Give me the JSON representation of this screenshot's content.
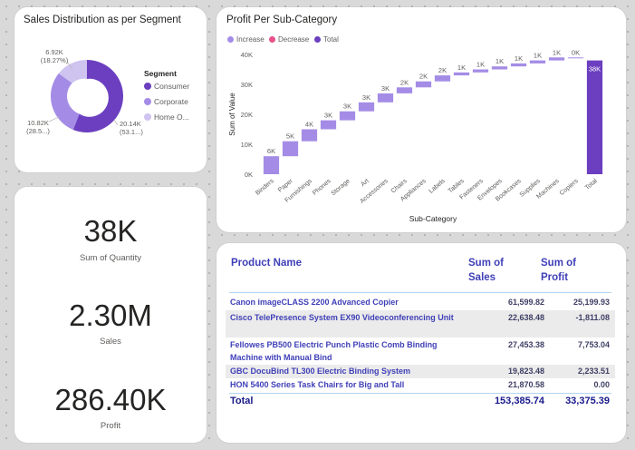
{
  "donut_card": {
    "title": "Sales Distribution as per Segment",
    "legend_title": "Segment",
    "legend": [
      {
        "label": "Consumer",
        "color": "#6b3fbf"
      },
      {
        "label": "Corporate",
        "color": "#a48ce6"
      },
      {
        "label": "Home O...",
        "color": "#cfc3f0"
      }
    ],
    "slice_labels": {
      "consumer_value": "20.14K",
      "consumer_pct": "(53.1...)",
      "corporate_value": "10.82K",
      "corporate_pct": "(28.5...)",
      "home_value": "6.92K",
      "home_pct": "(18.27%)"
    }
  },
  "chart_data": {
    "type": "bar",
    "subtype": "waterfall",
    "title": "Profit Per Sub-Category",
    "xlabel": "Sub-Category",
    "ylabel": "Sum of Value",
    "ylim": [
      0,
      40000
    ],
    "yticks": [
      "0K",
      "10K",
      "20K",
      "30K",
      "40K"
    ],
    "legend": [
      {
        "label": "Increase",
        "color": "#a48ce6"
      },
      {
        "label": "Decrease",
        "color": "#e8518a"
      },
      {
        "label": "Total",
        "color": "#6b3fbf"
      }
    ],
    "categories": [
      "Binders",
      "Paper",
      "Furnishings",
      "Phones",
      "Storage",
      "Art",
      "Accessories",
      "Chairs",
      "Appliances",
      "Labels",
      "Tables",
      "Fasteners",
      "Envelopes",
      "Bookcases",
      "Supplies",
      "Machines",
      "Copiers",
      "Total"
    ],
    "values": [
      6000,
      5000,
      4000,
      3000,
      3000,
      3000,
      3000,
      2000,
      2000,
      2000,
      1000,
      1000,
      1000,
      1000,
      1000,
      1000,
      0,
      38000
    ],
    "data_labels": [
      "6K",
      "5K",
      "4K",
      "3K",
      "3K",
      "3K",
      "3K",
      "2K",
      "2K",
      "2K",
      "1K",
      "1K",
      "1K",
      "1K",
      "1K",
      "1K",
      "0K",
      "38K"
    ]
  },
  "kpis": {
    "quantity_value": "38K",
    "quantity_label": "Sum of Quantity",
    "sales_value": "2.30M",
    "sales_label": "Sales",
    "profit_value": "286.40K",
    "profit_label": "Profit"
  },
  "table": {
    "headers": {
      "product": "Product Name",
      "sales": "Sum of Sales",
      "profit": "Sum of Profit"
    },
    "rows": [
      {
        "name": "Canon imageCLASS 2200 Advanced Copier",
        "sales": "61,599.82",
        "profit": "25,199.93"
      },
      {
        "name": "Cisco TelePresence System EX90 Videoconferencing Unit",
        "sales": "22,638.48",
        "profit": "-1,811.08"
      },
      {
        "name": "Fellowes PB500 Electric Punch Plastic Comb Binding Machine with Manual Bind",
        "sales": "27,453.38",
        "profit": "7,753.04"
      },
      {
        "name": "GBC DocuBind TL300 Electric Binding System",
        "sales": "19,823.48",
        "profit": "2,233.51"
      },
      {
        "name": "HON 5400 Series Task Chairs for Big and Tall",
        "sales": "21,870.58",
        "profit": "0.00"
      }
    ],
    "total": {
      "label": "Total",
      "sales": "153,385.74",
      "profit": "33,375.39"
    }
  }
}
